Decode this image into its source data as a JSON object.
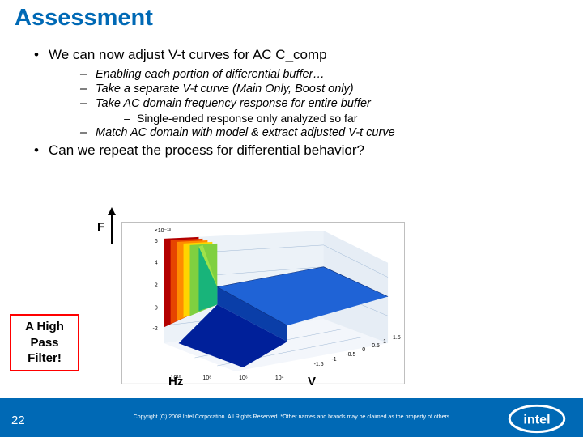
{
  "title": "Assessment",
  "bullets": {
    "main1": "We can now adjust V-t curves for AC C_comp",
    "sub1": "Enabling each portion of differential buffer…",
    "sub2": "Take a separate V-t curve (Main Only, Boost only)",
    "sub3": "Take AC domain frequency response for entire buffer",
    "sub3a": "Single-ended response only analyzed so far",
    "sub4": "Match AC domain with model & extract adjusted V-t curve",
    "main2": "Can we repeat the process for differential behavior?"
  },
  "chart_axes": {
    "f": "F",
    "hz": "Hz",
    "v": "V"
  },
  "callout": {
    "line1": "A High",
    "line2": "Pass",
    "line3": "Filter!"
  },
  "footer": {
    "page": "22",
    "copyright": "Copyright (C) 2008 Intel Corporation.  All Rights Reserved. *Other names and brands may be claimed as the property of others"
  },
  "chart_data": {
    "type": "surface",
    "title": "",
    "xlabel": "Hz",
    "ylabel": "V",
    "zlabel": "F",
    "x_scale": "log",
    "x_range_pow10": [
      4,
      10
    ],
    "y_range": [
      -1.5,
      1.5
    ],
    "z_scale_note": "×10^-13",
    "z_range": [
      -2,
      6
    ],
    "description": "3-D surface: low-frequency region is flat (magnitude step between negative and positive V), rising sharply above ~1e8 Hz — a high-pass-filter shaped response. Surface colored blue→cyan→green→yellow→orange→red with increasing value.",
    "series": [
      {
        "name": "low-Hz plateau (V<0)",
        "approx_z_e13": -0.5
      },
      {
        "name": "low-Hz plateau (V>0)",
        "approx_z_e13": 0.5
      },
      {
        "name": "high-Hz wall (≥1e8 Hz)",
        "approx_z_e13": 5.0
      }
    ]
  }
}
